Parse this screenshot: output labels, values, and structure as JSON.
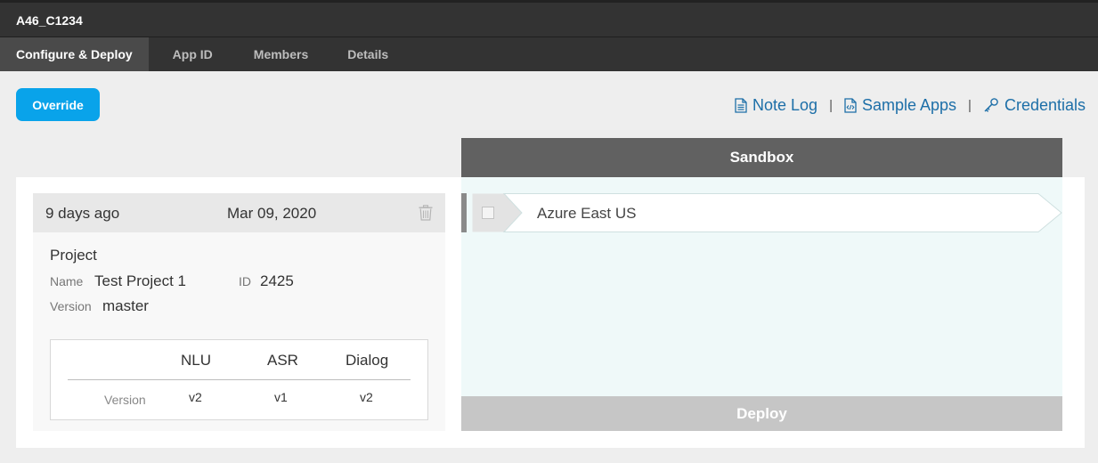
{
  "window": {
    "title": "A46_C1234"
  },
  "tabs": [
    {
      "label": "Configure & Deploy",
      "active": true
    },
    {
      "label": "App ID",
      "active": false
    },
    {
      "label": "Members",
      "active": false
    },
    {
      "label": "Details",
      "active": false
    }
  ],
  "toolbar": {
    "override_label": "Override",
    "links": {
      "note_log": "Note Log",
      "sample_apps": "Sample Apps",
      "credentials": "Credentials",
      "separator": "|"
    }
  },
  "deployment": {
    "age": "9 days ago",
    "date": "Mar 09, 2020",
    "project_heading": "Project",
    "name_label": "Name",
    "name_value": "Test Project 1",
    "id_label": "ID",
    "id_value": "2425",
    "version_label": "Version",
    "version_value": "master",
    "components": {
      "headers": [
        "NLU",
        "ASR",
        "Dialog"
      ],
      "row_label": "Version",
      "values": [
        "v2",
        "v1",
        "v2"
      ]
    }
  },
  "sandbox": {
    "title": "Sandbox",
    "region": "Azure East US",
    "region_checked": false,
    "deploy_label": "Deploy"
  },
  "colors": {
    "accent": "#09a3ea",
    "link": "#1d6fa8",
    "topbar": "#333333",
    "sandbox_header": "#616161",
    "sandbox_bg": "#eff9f9",
    "deploy_disabled": "#c6c6c6"
  }
}
